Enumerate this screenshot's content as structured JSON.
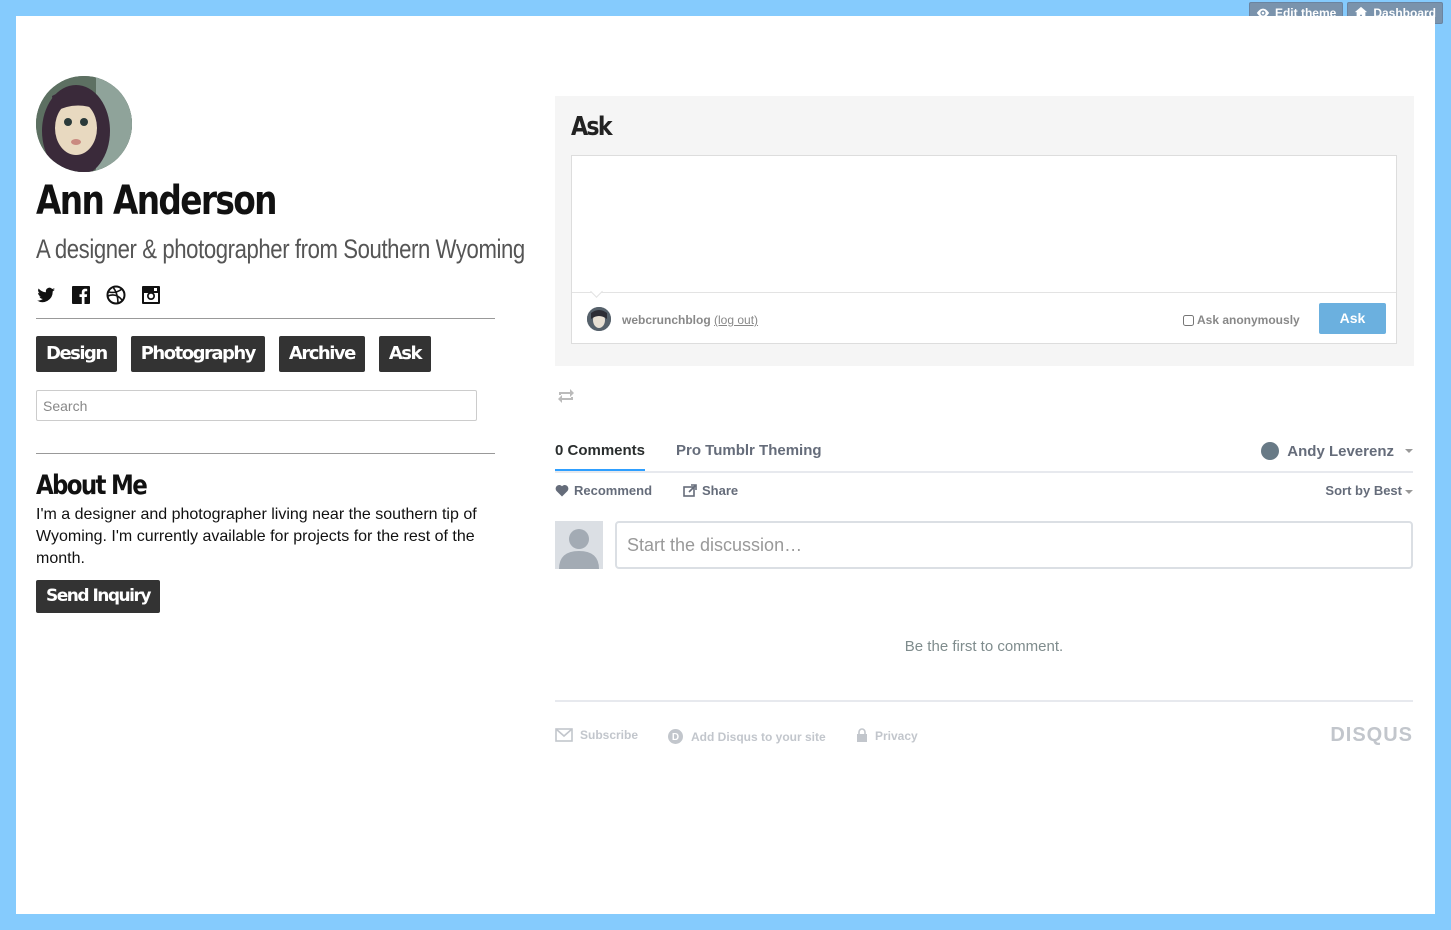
{
  "top_controls": {
    "edit_theme": "Edit theme",
    "dashboard": "Dashboard"
  },
  "profile": {
    "name": "Ann Anderson",
    "tagline": "A designer & photographer from Southern Wyoming",
    "social_icons": [
      "twitter-icon",
      "facebook-icon",
      "dribbble-icon",
      "instagram-icon"
    ]
  },
  "nav": {
    "items": [
      "Design",
      "Photography",
      "Archive",
      "Ask"
    ]
  },
  "search": {
    "placeholder": "Search"
  },
  "about": {
    "title": "About Me",
    "text": "I'm a designer and photographer living near the southern tip of Wyoming. I'm currently available for projects for the rest of the month.",
    "button": "Send Inquiry"
  },
  "ask": {
    "title": "Ask",
    "username": "webcrunchblog",
    "logout": "(log out)",
    "anonymous_label": "Ask anonymously",
    "submit": "Ask"
  },
  "disqus": {
    "comments_tab": "0 Comments",
    "site_tab": "Pro Tumblr Theming",
    "user": "Andy Leverenz",
    "recommend": "Recommend",
    "share": "Share",
    "sort": "Sort by Best",
    "input_placeholder": "Start the discussion…",
    "empty": "Be the first to comment.",
    "footer": {
      "subscribe": "Subscribe",
      "add": "Add Disqus to your site",
      "privacy": "Privacy",
      "logo": "DISQUS"
    }
  },
  "colors": {
    "frame": "#85cbfd",
    "accent_button": "#6bb0df",
    "dark_button": "#333333"
  }
}
